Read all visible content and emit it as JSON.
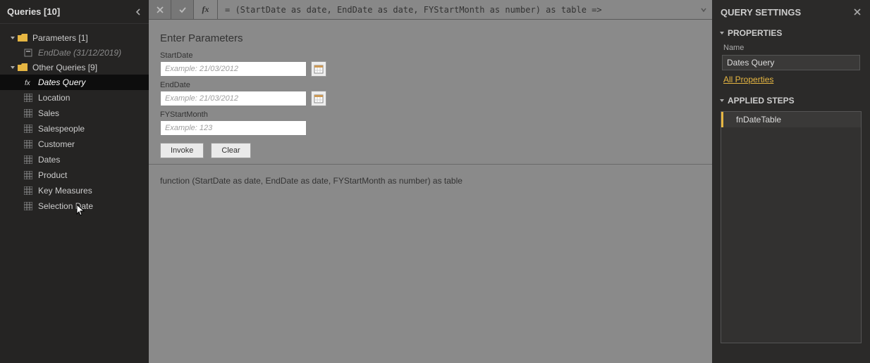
{
  "left": {
    "title": "Queries [10]",
    "groups": [
      {
        "label": "Parameters [1]",
        "items": [
          {
            "label": "EndDate (31/12/2019)",
            "type": "param",
            "dim": true
          }
        ]
      },
      {
        "label": "Other Queries [9]",
        "items": [
          {
            "label": "Dates Query",
            "type": "fx",
            "selected": true
          },
          {
            "label": "Location",
            "type": "table"
          },
          {
            "label": "Sales",
            "type": "table"
          },
          {
            "label": "Salespeople",
            "type": "table"
          },
          {
            "label": "Customer",
            "type": "table"
          },
          {
            "label": "Dates",
            "type": "table"
          },
          {
            "label": "Product",
            "type": "table"
          },
          {
            "label": "Key Measures",
            "type": "table"
          },
          {
            "label": "Selection Date",
            "type": "table"
          }
        ]
      }
    ]
  },
  "formula": {
    "text": "= (StartDate as date, EndDate as date, FYStartMonth as number) as table =>"
  },
  "params": {
    "heading": "Enter Parameters",
    "fields": [
      {
        "label": "StartDate",
        "placeholder": "Example: 21/03/2012",
        "datepicker": true
      },
      {
        "label": "EndDate",
        "placeholder": "Example: 21/03/2012",
        "datepicker": true
      },
      {
        "label": "FYStartMonth",
        "placeholder": "Example: 123",
        "datepicker": false
      }
    ],
    "buttons": {
      "invoke": "Invoke",
      "clear": "Clear"
    }
  },
  "signature": {
    "prefix": "function (",
    "p1name": "StartDate",
    "p1type": " as date, ",
    "p2name": "EndDate",
    "p2type": " as date, ",
    "p3name": "FYStartMonth",
    "p3type": " as number) as table"
  },
  "right": {
    "title": "QUERY SETTINGS",
    "propsHeader": "PROPERTIES",
    "nameLabel": "Name",
    "nameValue": "Dates Query",
    "allPropsLabel": "All Properties",
    "stepsHeader": "APPLIED STEPS",
    "steps": [
      "fnDateTable"
    ]
  }
}
